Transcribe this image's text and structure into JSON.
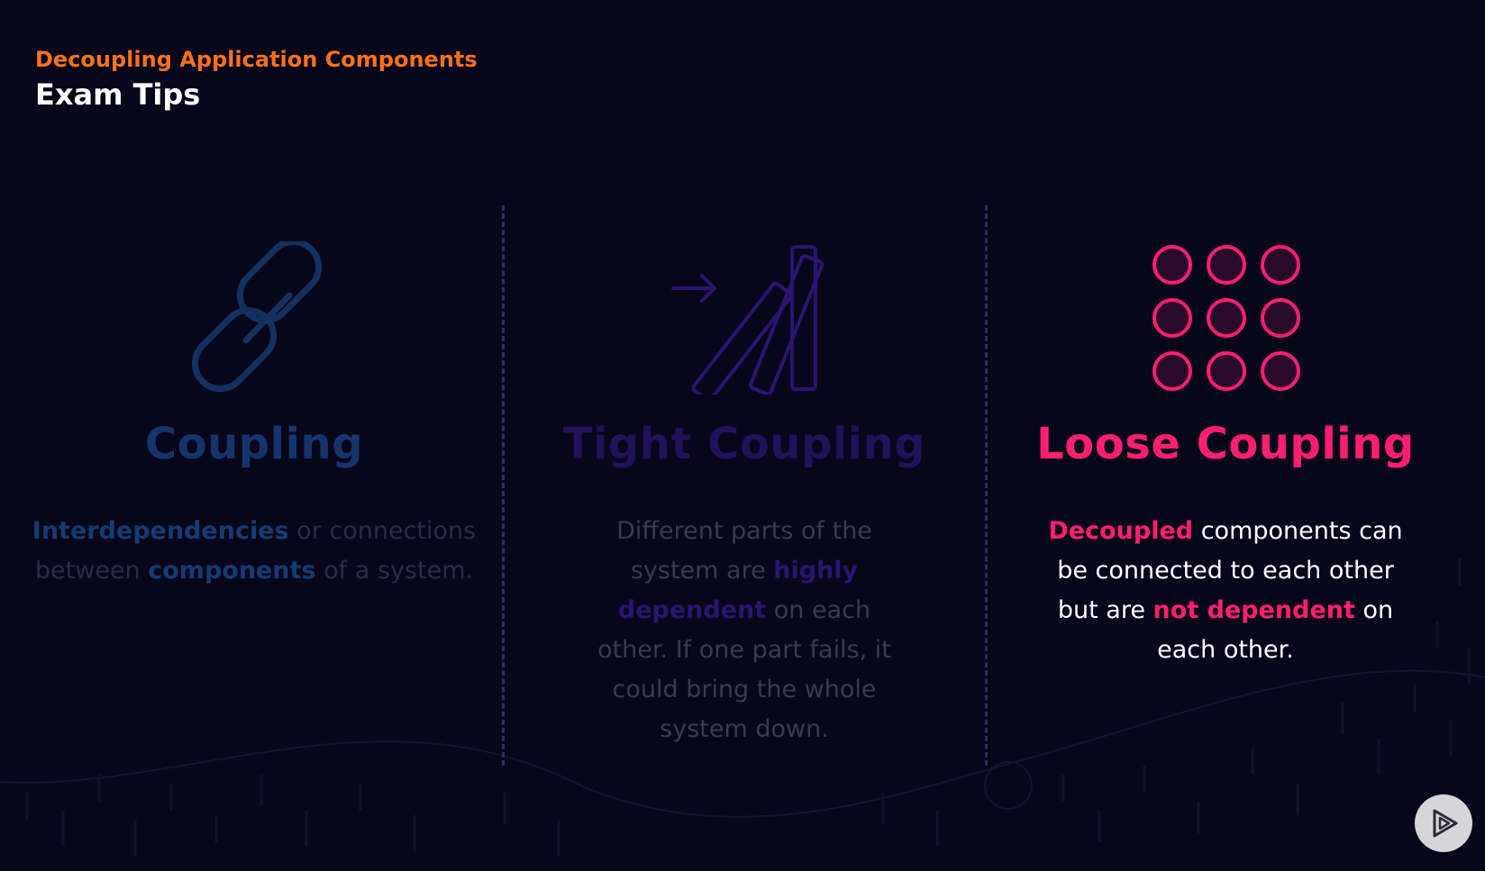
{
  "header": {
    "subtitle": "Decoupling Application Components",
    "title": "Exam Tips"
  },
  "columns": [
    {
      "icon": "chain-link-icon",
      "heading": "Coupling",
      "text": {
        "p1_bold": "Interdependencies",
        "p2": " or connections between ",
        "p3_bold": "components",
        "p4": " of a system."
      }
    },
    {
      "icon": "falling-dominoes-icon",
      "heading": "Tight Coupling",
      "text": {
        "p1": "Different parts of the system are ",
        "p2_bold": "highly dependent",
        "p3": " on each other. If one part fails, it could bring the whole system down."
      }
    },
    {
      "icon": "dot-grid-icon",
      "heading": "Loose Coupling",
      "text": {
        "p1_bold": "Decoupled",
        "p2": " components can be connected to each other but are ",
        "p3_bold": "not dependent",
        "p4": " on each other."
      }
    }
  ],
  "colors": {
    "accent_orange": "#f7711c",
    "accent_pink": "#ff1f6e",
    "background": "#07061a"
  }
}
